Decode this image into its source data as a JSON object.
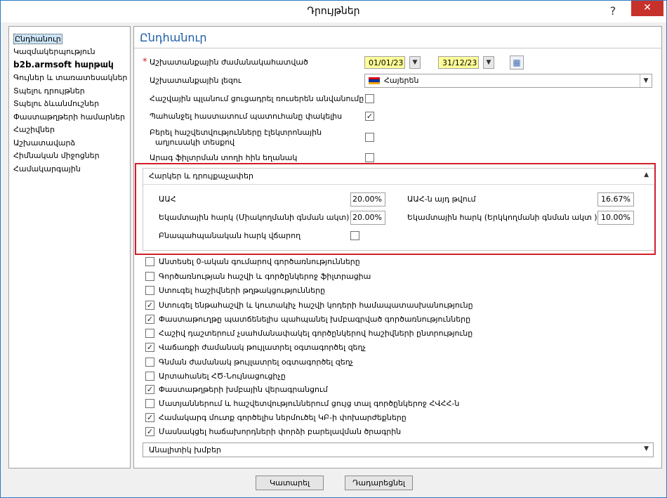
{
  "window": {
    "title": "Դրույթներ",
    "help_glyph": "?",
    "close_glyph": "✕"
  },
  "nav": {
    "items": [
      {
        "label": "Ընդհանուր",
        "selected": true
      },
      {
        "label": "Կազմակերպություն"
      },
      {
        "label": "b2b.armsoft hարթակ",
        "bold": true
      },
      {
        "label": "Գույներ և տառատեսակներ"
      },
      {
        "label": "Տպելու դրույթներ"
      },
      {
        "label": "Տպելու ձևանմուշներ"
      },
      {
        "label": "Փաստաթղթերի համարներ"
      },
      {
        "label": "Հաշիվներ"
      },
      {
        "label": "Աշխատավարձ"
      },
      {
        "label": "Հիմնական միջոցներ"
      },
      {
        "label": "Համակարգային"
      }
    ]
  },
  "main": {
    "section_title": "Ընդհանուր",
    "work_period": {
      "label": "Աշխատանքային ժամանակահատված",
      "required_mark": "*",
      "from": "01/01/23",
      "to": "31/12/23"
    },
    "language": {
      "label": "Աշխատանքային լեզու",
      "value": "Հայերեն"
    },
    "settings": [
      {
        "label": "Հաշվային պլանում ցուցադրել ռուսերեն անվանումը",
        "checked": false
      },
      {
        "label": "Պահանջել հաստատում պատուհանը փակելիս",
        "checked": true
      },
      {
        "label": "Բերել հաշվետվությունները էլեկտրոնային",
        "label2": "աղյուսակի տեսքով",
        "checked": false
      },
      {
        "label": "Արագ ֆիլտրման տողի հին եղանակ",
        "checked": false
      }
    ],
    "taxes_group": {
      "title": "Հարկեր և դրույքաչափեր",
      "vat_label": "ԱԱՀ",
      "vat_value": "20.00%",
      "vat_extra_label": "ԱԱՀ-ն այդ թվում",
      "vat_extra_value": "16.67%",
      "profit_tax1_label": "Եկամտային հարկ (Միակողմանի գնման ակտ)",
      "profit_tax1_value": "20.00%",
      "profit_tax2_label": "Եկամտային հարկ (Երկկողմանի գնման ակտ )",
      "profit_tax2_value": "10.00%",
      "env_tax_label": "Բնապահպանական հարկ վճարող",
      "env_tax_checked": false
    },
    "options": [
      {
        "label": "Անտեսել 0-ական գումարով գործառնությունները",
        "checked": false
      },
      {
        "label": "Գործառնության հաշվի և գործընկերոջ ֆիլտրացիա",
        "checked": false
      },
      {
        "label": "Ստուգել հաշիվների թղթակցությունները",
        "checked": false
      },
      {
        "label": "Ստուգել ենթահաշվի և կուտակիչ հաշվի կոդերի համապատասխանությունը",
        "checked": true
      },
      {
        "label": "Փաստաթուղթը պատճենելիս պահպանել խմբագրված գործառնությունները",
        "checked": true
      },
      {
        "label": "Հաշիվ դաշտերում չսահմանափակել գործընկերով հաշիվների ընտրությունը",
        "checked": false
      },
      {
        "label": "Վաճառքի ժամանակ թույլատրել օգտագործել զեղչ",
        "checked": true
      },
      {
        "label": "Գնման ժամանակ թույլատրել օգտագործել զեղչ",
        "checked": false
      },
      {
        "label": "Արտահանել ՀԾ-Նույնացուցիչը",
        "checked": false
      },
      {
        "label": "Փաստաթղթերի խմբային վերագրանցում",
        "checked": true
      },
      {
        "label": "Մատյաններում և հաշվետվություններում ցույց տալ գործընկերոջ ՀՎՀՀ-ն",
        "checked": false
      },
      {
        "label": "Համակարգ մուտք գործելիս ներմուծել ԿԲ-ի փոխարժեքները",
        "checked": true
      },
      {
        "label": "Մասնակցել հաճախորդների փորձի բարելավման ծրագրին",
        "checked": true
      }
    ],
    "analytic_groups": "Անալիտիկ խմբեր"
  },
  "buttons": {
    "ok": "Կատարել",
    "cancel": "Դադարեցնել"
  },
  "colors": {
    "accent": "#1f5ea8",
    "date_bg": "#ffff99",
    "close_bg": "#c7312b",
    "highlight_border": "#d21f27"
  }
}
